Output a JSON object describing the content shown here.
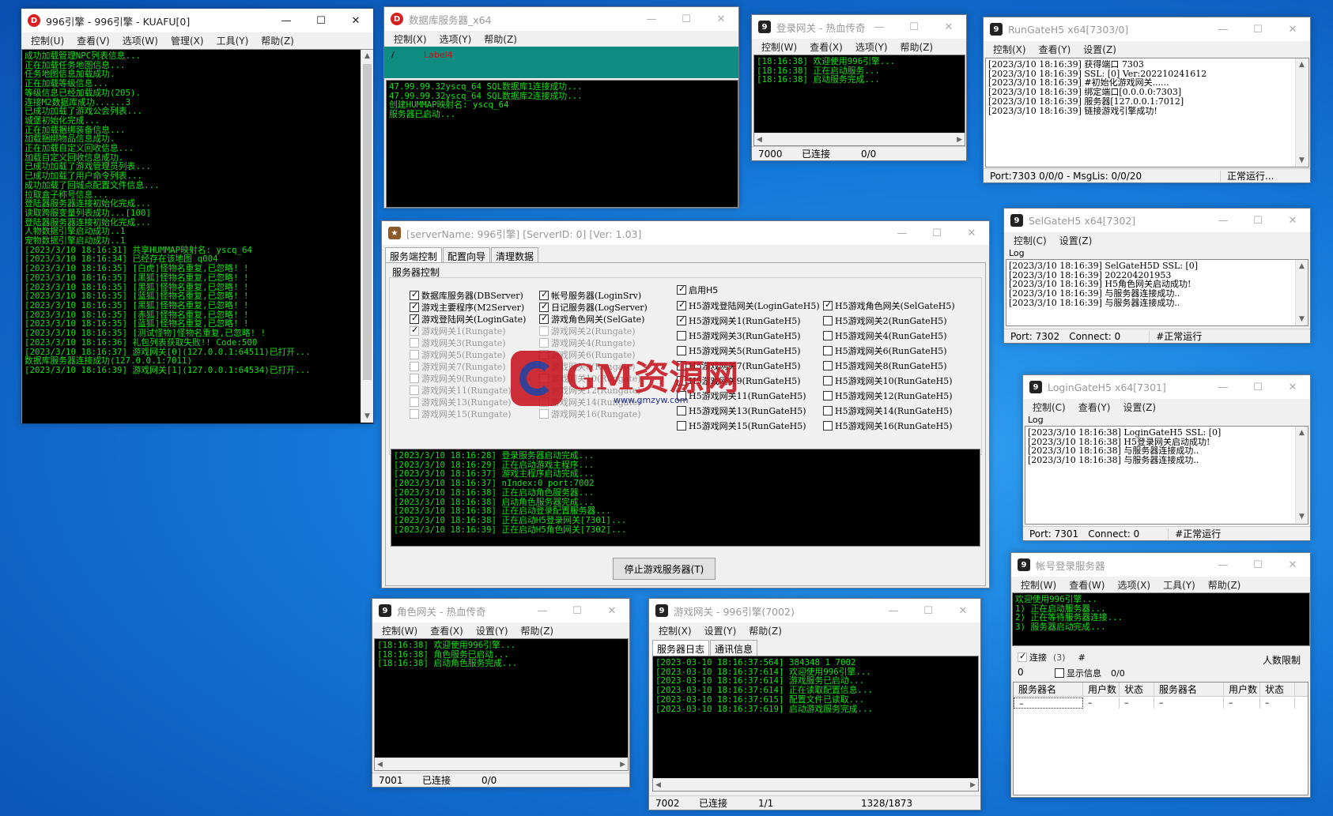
{
  "w_kuafu": {
    "title": "996引擎 - 996引擎 - KUAFU[0]",
    "menu": [
      "控制(U)",
      "查看(V)",
      "选项(W)",
      "管理(X)",
      "工具(Y)",
      "帮助(Z)"
    ],
    "log": "成功加载管理NPC列表信息...\n正在加载任务地图信息...\n任务地图信息加载成功.\n正在加载等级信息...\n等级信息已经加载成功(205).\n连接M2数据库成功......3\n已成功加载了游戏公会列表...\n城堡初始化完成...\n正在加载捆绑装备信息...\n加载捆绑物品信息成功.\n正在加载自定义回收信息...\n加载自定义回收信息成功.\n已成功加载了游戏管理员列表...\n已成功加载了用户命令列表...\n成功加载了回城点配置文件信息...\n拉取盒子称号信息...\n登陆器服务器连接初始化完成...\n读取跨服变量列表成功...[100]\n登陆器服务器连接初始化完成...\n人物数据引擎启动成功..1\n宠物数据引擎启动成功..1\n[2023/3/10 18:16:31] 共享HUMMAP映射名: yscq_64\n[2023/3/10 18:16:34] 已经存在该地图 q004\n[2023/3/10 18:16:35] [白虎]怪物名重复,已忽略! !\n[2023/3/10 18:16:35] [黑狐]怪物名重复,已忽略! !\n[2023/3/10 18:16:35] [黑狐]怪物名重复,已忽略! !\n[2023/3/10 18:16:35] [蓝狐]怪物名重复,已忽略! !\n[2023/3/10 18:16:35] [黑狐]怪物名重复,已忽略! !\n[2023/3/10 18:16:35] [赤狐]怪物名重复,已忽略! !\n[2023/3/10 18:16:35] [蓝狐]怪物名重复,已忽略! !\n[2023/3/10 18:16:35] [测试怪物]怪物名重复,已忽略! !\n[2023/3/10 18:16:36] 礼包列表获取失败!! Code:500\n[2023/3/10 18:16:37] 游戏网关[0](127.0.0.1:64511)已打开...\n数据库服务器连接成功(127.0.0.1:7011)\n[2023/3/10 18:16:39] 游戏网关[1](127.0.0.1:64534)已打开..."
  },
  "w_db": {
    "title": "数据库服务器_x64",
    "menu": [
      "控制(X)",
      "选项(Y)",
      "帮助(Z)"
    ],
    "label_slash": "/",
    "label4": "Label4",
    "log": "47.99.99.32yscq_64 SQL数据库1连接成功...\n47.99.99.32yscq_64 SQL数据库2连接成功...\n创建HUMMAP映射名: yscq_64\n服务器已启动..."
  },
  "w_login_gate": {
    "title": "登录网关 - 热血传奇",
    "menu": [
      "控制(W)",
      "查看(X)",
      "选项(Y)",
      "帮助(Z)"
    ],
    "log": "[18:16:38] 欢迎使用996引擎...\n[18:16:38] 正在启动服务...\n[18:16:38] 启动服务完成...",
    "status": [
      "7000",
      "已连接",
      "0/0"
    ]
  },
  "w_rungate": {
    "title": "RunGateH5 x64[7303/0]",
    "menu": [
      "控制(X)",
      "查看(Y)",
      "设置(Z)"
    ],
    "log": "[2023/3/10 18:16:39] 获得端口 7303\n[2023/3/10 18:16:39] SSL: [0] Ver:202210241612\n[2023/3/10 18:16:39] #初始化游戏网关......\n[2023/3/10 18:16:39] 绑定端口[0.0.0.0:7303]\n[2023/3/10 18:16:39] 服务器[127.0.0.1:7012]\n[2023/3/10 18:16:39] 链接游戏引擎成功!",
    "status": [
      "Port:7303 0/0/0 - MsgLis: 0/0/20",
      "正常运行..."
    ]
  },
  "w_main": {
    "title": "[serverName: 996引擎] [ServerID: 0] [Ver: 1.03]",
    "tabs": [
      "服务端控制",
      "配置向导",
      "清理数据"
    ],
    "group_title": "服务器控制",
    "col1": [
      {
        "label": "数据库服务器(DBServer)",
        "checked": true,
        "disabled": false
      },
      {
        "label": "游戏主要程序(M2Server)",
        "checked": true,
        "disabled": false
      },
      {
        "label": "游戏登陆网关(LoginGate)",
        "checked": true,
        "disabled": false
      },
      {
        "label": "游戏网关1(Rungate)",
        "checked": true,
        "disabled": true
      },
      {
        "label": "游戏网关3(Rungate)",
        "checked": false,
        "disabled": true
      },
      {
        "label": "游戏网关5(Rungate)",
        "checked": false,
        "disabled": true
      },
      {
        "label": "游戏网关7(Rungate)",
        "checked": false,
        "disabled": true
      },
      {
        "label": "游戏网关9(Rungate)",
        "checked": false,
        "disabled": true
      },
      {
        "label": "游戏网关11(Rungate)",
        "checked": false,
        "disabled": true
      },
      {
        "label": "游戏网关13(Rungate)",
        "checked": false,
        "disabled": true
      },
      {
        "label": "游戏网关15(Rungate)",
        "checked": false,
        "disabled": true
      }
    ],
    "col2": [
      {
        "label": "帐号服务器(LoginSrv)",
        "checked": true,
        "disabled": false
      },
      {
        "label": "日记服务器(LogServer)",
        "checked": true,
        "disabled": false
      },
      {
        "label": "游戏角色网关(SelGate)",
        "checked": true,
        "disabled": false
      },
      {
        "label": "游戏网关2(Rungate)",
        "checked": false,
        "disabled": true
      },
      {
        "label": "游戏网关4(Rungate)",
        "checked": false,
        "disabled": true
      },
      {
        "label": "游戏网关6(Rungate)",
        "checked": false,
        "disabled": true
      },
      {
        "label": "游戏网关8(Rungate)",
        "checked": false,
        "disabled": true
      },
      {
        "label": "游戏网关10(Rungate)",
        "checked": false,
        "disabled": true
      },
      {
        "label": "游戏网关12(Rungate)",
        "checked": false,
        "disabled": true
      },
      {
        "label": "游戏网关14(Rungate)",
        "checked": false,
        "disabled": true
      },
      {
        "label": "游戏网关16(Rungate)",
        "checked": false,
        "disabled": true
      }
    ],
    "enable_h5": "启用H5",
    "col3": [
      {
        "label": "H5游戏登陆网关(LoginGateH5)",
        "checked": true
      },
      {
        "label": "H5游戏网关1(RunGateH5)",
        "checked": true
      },
      {
        "label": "H5游戏网关3(RunGateH5)",
        "checked": false
      },
      {
        "label": "H5游戏网关5(RunGateH5)",
        "checked": false
      },
      {
        "label": "H5游戏网关7(RunGateH5)",
        "checked": false
      },
      {
        "label": "H5游戏网关9(RunGateH5)",
        "checked": false
      },
      {
        "label": "H5游戏网关11(RunGateH5)",
        "checked": false
      },
      {
        "label": "H5游戏网关13(RunGateH5)",
        "checked": false
      },
      {
        "label": "H5游戏网关15(RunGateH5)",
        "checked": false
      }
    ],
    "col4": [
      {
        "label": "H5游戏角色网关(SelGateH5)",
        "checked": true
      },
      {
        "label": "H5游戏网关2(RunGateH5)",
        "checked": false
      },
      {
        "label": "H5游戏网关4(RunGateH5)",
        "checked": false
      },
      {
        "label": "H5游戏网关6(RunGateH5)",
        "checked": false
      },
      {
        "label": "H5游戏网关8(RunGateH5)",
        "checked": false
      },
      {
        "label": "H5游戏网关10(RunGateH5)",
        "checked": false
      },
      {
        "label": "H5游戏网关12(RunGateH5)",
        "checked": false
      },
      {
        "label": "H5游戏网关14(RunGateH5)",
        "checked": false
      },
      {
        "label": "H5游戏网关16(RunGateH5)",
        "checked": false
      }
    ],
    "log": "[2023/3/10 18:16:28] 登录服务器启动完成...\n[2023/3/10 18:16:29] 正在启动游戏主程序...\n[2023/3/10 18:16:37] 游戏主程序启动完成...\n[2023/3/10 18:16:37] nIndex:0 port:7002\n[2023/3/10 18:16:38] 正在启动角色服务器...\n[2023/3/10 18:16:38] 启动角色服务器完成...\n[2023/3/10 18:16:38] 正在启动登录配置服务器...\n[2023/3/10 18:16:38] 正在启动H5登录网关[7301]...\n[2023/3/10 18:16:39] 正在启动H5角色网关[7302]...",
    "stop_button": "停止游戏服务器(T)"
  },
  "w_selgate": {
    "title": "SelGateH5 x64[7302]",
    "menu": [
      "控制(C)",
      "设置(Z)"
    ],
    "log_label": "Log",
    "log": "[2023/3/10 18:16:39] SelGateH5D SSL: [0]\n[2023/3/10 18:16:39] 202204201953\n[2023/3/10 18:16:39] H5角色网关启动成功!\n[2023/3/10 18:16:39] 与服务器连接成功..\n[2023/3/10 18:16:39] 与服务器连接成功..",
    "status": [
      "Port: 7302",
      "Connect: 0",
      "#正常运行"
    ]
  },
  "w_logingate_h5": {
    "title": "LoginGateH5 x64[7301]",
    "menu": [
      "控制(C)",
      "查看(Y)",
      "设置(Z)"
    ],
    "log_label": "Log",
    "log": "[2023/3/10 18:16:38] LoginGateH5 SSL: [0]\n[2023/3/10 18:16:38] H5登录网关启动成功!\n[2023/3/10 18:16:38] 与服务器连接成功..\n[2023/3/10 18:16:38] 与服务器连接成功..",
    "status": [
      "Port: 7301",
      "Connect: 0",
      "#正常运行"
    ]
  },
  "w_account": {
    "title": "帐号登录服务器",
    "menu": [
      "控制(W)",
      "查看(W)",
      "选项(X)",
      "工具(Y)",
      "帮助(Z)"
    ],
    "log": "欢迎使用996引擎...\n1) 正在启动服务器...\n2) 正在等待服务器连接...\n3) 服务器启动完成...",
    "connect_label": "连接",
    "connect_count": "(3)",
    "hash": "#",
    "limit_label": "人数限制",
    "zero": "0",
    "show_info": "显示信息",
    "ratio": "0/0",
    "grid_headers": [
      "服务器名",
      "用户数",
      "状态",
      "服务器名",
      "用户数",
      "状态"
    ],
    "grid_row": [
      "–",
      "–",
      "–",
      "–",
      "–",
      "–"
    ]
  },
  "w_role_gate": {
    "title": "角色网关 - 热血传奇",
    "menu": [
      "控制(W)",
      "查看(X)",
      "设置(Y)",
      "帮助(Z)"
    ],
    "log": "[18:16:38] 欢迎使用996引擎...\n[18:16:38] 角色服务已启动...\n[18:16:38] 启动角色服务完成...",
    "status": [
      "7001",
      "已连接",
      "0/0"
    ]
  },
  "w_game_gate": {
    "title": "游戏网关 - 996引擎(7002)",
    "menu": [
      "控制(X)",
      "设置(Y)",
      "帮助(Z)"
    ],
    "tabs": [
      "服务器日志",
      "通讯信息"
    ],
    "log": "[2023-03-10 18:16:37:564] 384348 1 7002\n[2023-03-10 18:16:37:614] 欢迎使用996引擎...\n[2023-03-10 18:16:37:614] 游戏服务已启动...\n[2023-03-10 18:16:37:614] 正在读取配置信息...\n[2023-03-10 18:16:37:615] 配置文件已读取...\n[2023-03-10 18:16:37:619] 启动游戏服务完成...",
    "status": [
      "7002",
      "已连接",
      "1/1",
      "1328/1873"
    ]
  },
  "watermark": {
    "text": "GM资源网",
    "url": "www.gmzyw.com"
  },
  "colors": {
    "console_bg": "#000000",
    "console_text": "#16e016",
    "desktop": "#1478d8",
    "label4": "#cc1111",
    "teal": "#0f8c82"
  },
  "icons": {
    "close": "close-icon",
    "minimize": "minimize-icon",
    "maximize": "maximize-icon"
  }
}
